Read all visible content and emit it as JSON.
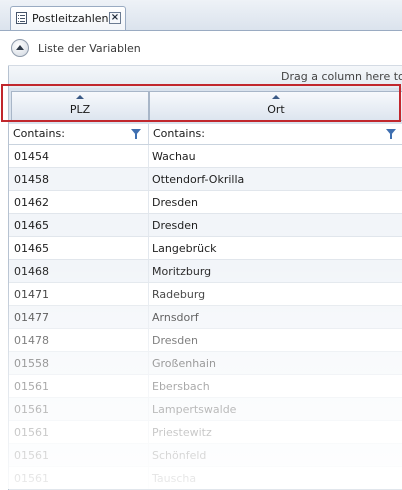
{
  "tab": {
    "title": "Postleitzahlen",
    "icon": "list-icon",
    "close_icon": "close-icon"
  },
  "panel": {
    "title": "Liste der Variablen",
    "collapse_icon": "chevron-up-icon"
  },
  "grid": {
    "group_hint": "Drag a column here to g",
    "columns": [
      {
        "label": "PLZ",
        "filter": "Contains:"
      },
      {
        "label": "Ort",
        "filter": "Contains:"
      }
    ],
    "rows": [
      {
        "plz": "01454",
        "ort": "Wachau"
      },
      {
        "plz": "01458",
        "ort": "Ottendorf-Okrilla"
      },
      {
        "plz": "01462",
        "ort": "Dresden"
      },
      {
        "plz": "01465",
        "ort": "Dresden"
      },
      {
        "plz": "01465",
        "ort": "Langebrück"
      },
      {
        "plz": "01468",
        "ort": "Moritzburg"
      },
      {
        "plz": "01471",
        "ort": "Radeburg"
      },
      {
        "plz": "01477",
        "ort": "Arnsdorf"
      },
      {
        "plz": "01478",
        "ort": "Dresden"
      },
      {
        "plz": "01558",
        "ort": "Großenhain"
      },
      {
        "plz": "01561",
        "ort": "Ebersbach"
      },
      {
        "plz": "01561",
        "ort": "Lampertswalde"
      },
      {
        "plz": "01561",
        "ort": "Priestewitz"
      },
      {
        "plz": "01561",
        "ort": "Schönfeld"
      },
      {
        "plz": "01561",
        "ort": "Tauscha"
      }
    ]
  },
  "colors": {
    "highlight": "#c1272d",
    "accent": "#3f6fb0"
  }
}
